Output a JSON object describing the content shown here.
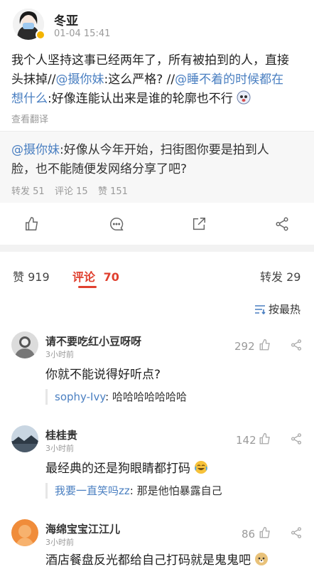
{
  "post": {
    "author": "冬亚",
    "time": "01-04 15:41",
    "body_plain1": "我个人坚持这事已经两年了，所有被拍到的人，直接",
    "body_plain2": "头抹掉//",
    "mention1": "@摄你妹",
    "body_plain3": ":这么严格? //",
    "mention2": "@睡不着的时候都在",
    "mention2b": "想什么",
    "body_plain4": ":好像连能认出来是谁的轮廓也不行",
    "translate": "查看翻译"
  },
  "quoted": {
    "mention": "@摄你妹",
    "text1": ":好像从今年开始，扫街图你要是拍到人",
    "text2": "脸，也不能随便发网络分享了吧?",
    "repost": "转发 51",
    "comment": "评论 15",
    "like": "赞 151"
  },
  "stats": {
    "likes": "赞 919",
    "comments_label": "评论",
    "comments_count": "70",
    "reposts": "转发 29",
    "sort": "按最热"
  },
  "comments": [
    {
      "user": "请不要吃红小豆呀呀",
      "time": "3小时前",
      "likes": "292",
      "text": "你就不能说得好听点?",
      "reply_user": "sophy-Ivy",
      "reply_text": ": 哈哈哈哈哈哈哈"
    },
    {
      "user": "桂桂贵",
      "time": "3小时前",
      "likes": "142",
      "text": "最经典的还是狗眼睛都打码",
      "reply_user": "我要一直笑吗zz",
      "reply_text": ": 那是他怕暴露自己"
    },
    {
      "user": "海绵宝宝江江儿",
      "time": "3小时前",
      "likes": "86",
      "text": "酒店餐盘反光都给自己打码就是鬼鬼吧"
    }
  ],
  "colors": {
    "link": "#4a7fc1",
    "accent_red": "#e0402f",
    "gold_badge": "#f4b400"
  }
}
